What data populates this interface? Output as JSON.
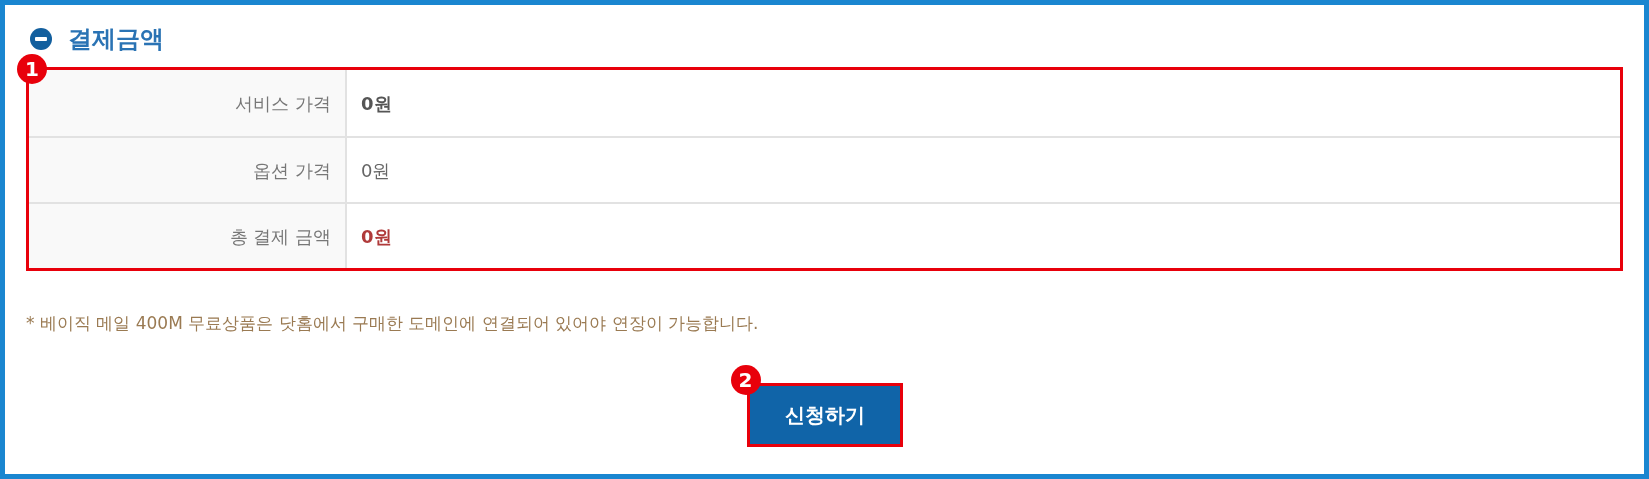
{
  "section": {
    "title": "결제금액"
  },
  "price_table": {
    "marker": "1",
    "rows": [
      {
        "label": "서비스 가격",
        "value": "0원",
        "kind": "bold"
      },
      {
        "label": "옵션 가격",
        "value": "0원",
        "kind": "plain"
      },
      {
        "label": "총 결제 금액",
        "value": "0원",
        "kind": "total"
      }
    ]
  },
  "note": "* 베이직 메일 400M 무료상품은 닷홈에서 구매한 도메인에 연결되어 있어야 연장이 가능합니다.",
  "apply_button": {
    "label": "신청하기",
    "marker": "2"
  }
}
